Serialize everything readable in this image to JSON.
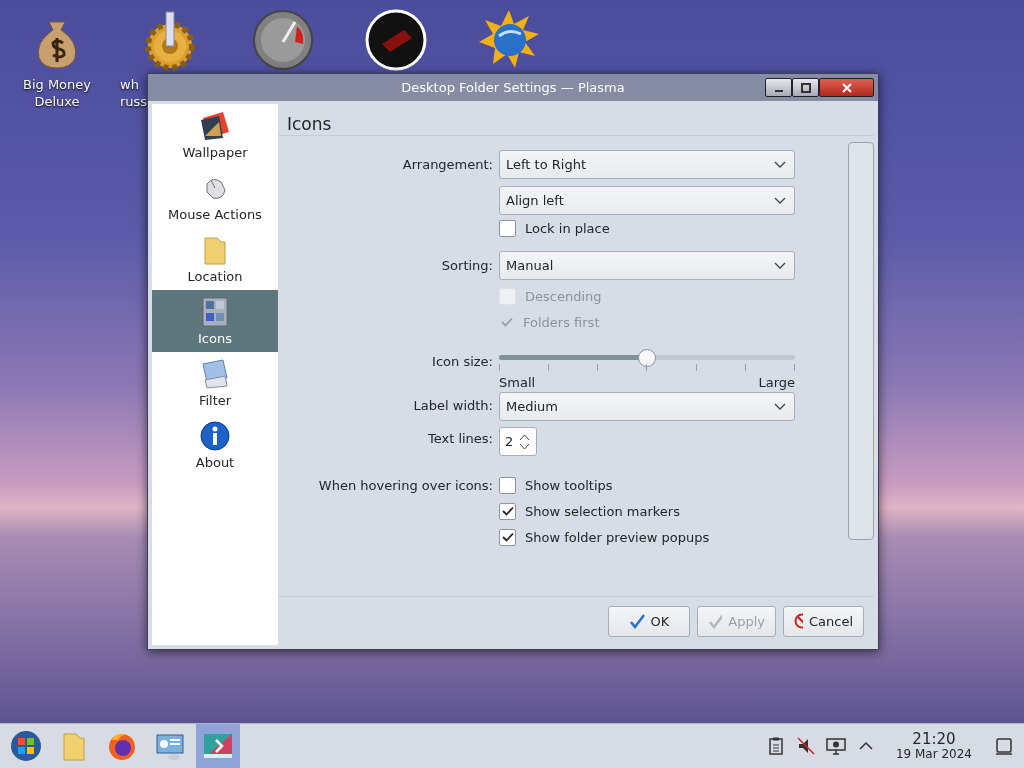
{
  "desktop_icons": [
    {
      "kind": "full",
      "lines": [
        "Big Money",
        "Deluxe"
      ]
    },
    {
      "kind": "partial",
      "lines": [
        "wh",
        "russ"
      ]
    },
    {
      "kind": "hidden"
    },
    {
      "kind": "hidden"
    },
    {
      "kind": "hidden"
    }
  ],
  "window": {
    "title": "Desktop Folder Settings — Plasma"
  },
  "sidebar": {
    "items": [
      {
        "label": "Wallpaper",
        "selected": false
      },
      {
        "label": "Mouse Actions",
        "selected": false
      },
      {
        "label": "Location",
        "selected": false
      },
      {
        "label": "Icons",
        "selected": true
      },
      {
        "label": "Filter",
        "selected": false
      },
      {
        "label": "About",
        "selected": false
      }
    ]
  },
  "page_title": "Icons",
  "form": {
    "arrangement": {
      "label": "Arrangement:",
      "value": "Left to Right"
    },
    "alignment": {
      "value": "Align left"
    },
    "lock_in_place": {
      "label": "Lock in place",
      "checked": false
    },
    "sorting": {
      "label": "Sorting:",
      "value": "Manual"
    },
    "descending": {
      "label": "Descending",
      "checked": false,
      "disabled": true
    },
    "folders_first": {
      "label": "Folders first",
      "checked": true,
      "disabled": true
    },
    "icon_size": {
      "label": "Icon size:",
      "level": 0.5,
      "min_label": "Small",
      "max_label": "Large"
    },
    "label_width": {
      "label": "Label width:",
      "value": "Medium"
    },
    "text_lines": {
      "label": "Text lines:",
      "value": "2"
    },
    "hover": {
      "label": "When hovering over icons:",
      "options": [
        {
          "label": "Show tooltips",
          "checked": false
        },
        {
          "label": "Show selection markers",
          "checked": true
        },
        {
          "label": "Show folder preview popups",
          "checked": true
        }
      ]
    }
  },
  "buttons": [
    {
      "label": "OK",
      "kind": "ok",
      "disabled": false
    },
    {
      "label": "Apply",
      "kind": "apply",
      "disabled": true
    },
    {
      "label": "Cancel",
      "kind": "cancel",
      "disabled": false
    }
  ],
  "taskbar": {
    "tasks": [
      {
        "selected": false
      },
      {
        "selected": false
      },
      {
        "selected": false
      },
      {
        "selected": false
      },
      {
        "selected": true
      }
    ],
    "clock": {
      "time": "21:20",
      "date": "19 Mar 2024"
    }
  }
}
